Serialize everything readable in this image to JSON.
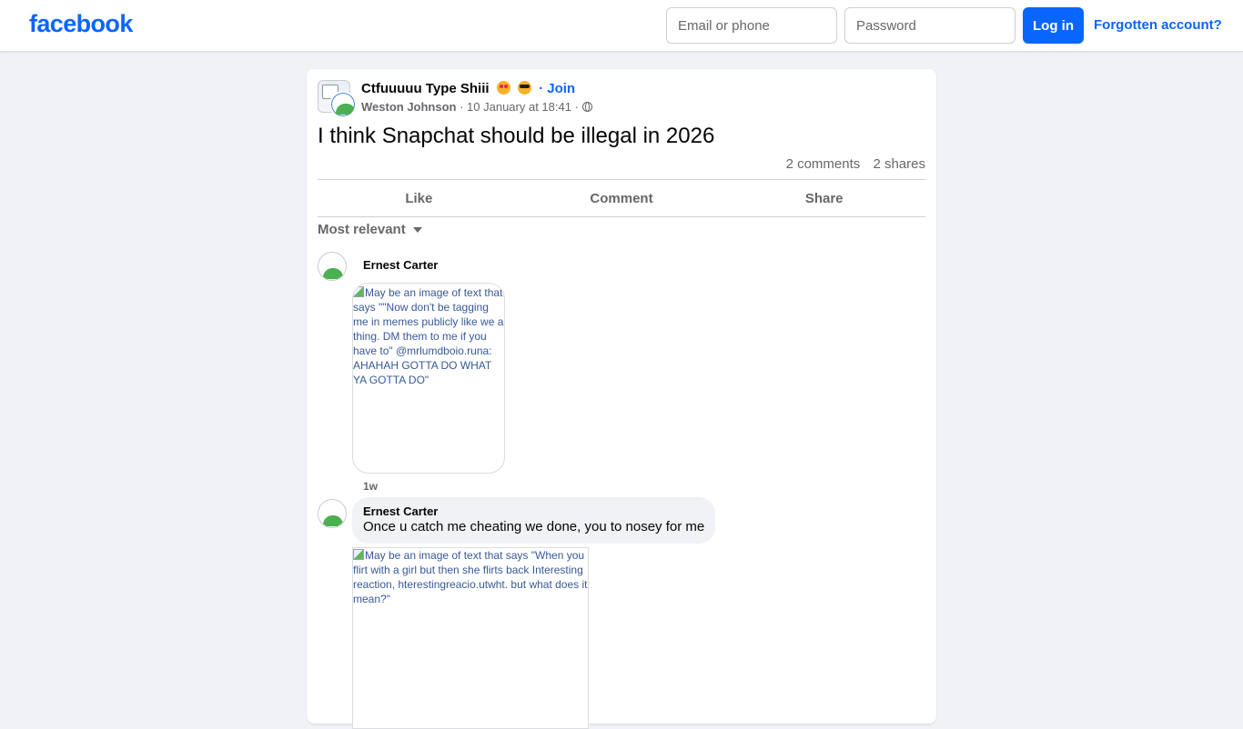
{
  "brand": {
    "logo_text": "facebook",
    "color": "#0866ff"
  },
  "login": {
    "email_placeholder": "Email or phone",
    "password_placeholder": "Password",
    "login_label": "Log in",
    "forgot_label": "Forgotten account?"
  },
  "post": {
    "group_name": "Ctfuuuuu Type Shiii",
    "group_emojis": [
      "heart-eyes-emoji",
      "sunglasses-emoji"
    ],
    "join_label": "· Join",
    "author": "Weston Johnson",
    "date": "· 10 January at 18:41 ·",
    "privacy_icon": "globe-icon",
    "text": "I think Snapchat should be illegal in 2026",
    "comments_count": "2 comments",
    "shares_count": "2 shares",
    "actions": {
      "like": "Like",
      "comment": "Comment",
      "share": "Share"
    },
    "sort_label": "Most relevant"
  },
  "comments": [
    {
      "author": "Ernest Carter",
      "image_alt": "May be an image of text that says \"\"Now don't be tagging me in memes publicly like we a thing. DM them to me if you have to\" @mrlumdboio.runa: AHAHAH GOTTA DO WHAT YA GOTTA DO\"",
      "time": "1w"
    },
    {
      "author": "Ernest Carter",
      "text": "Once u catch me cheating we done, you to nosey for me",
      "image_alt": "May be an image of text that says \"When you flirt with a girl but then she flirts back Interesting reaction, hterestingreacio.utwht. but what does it mean?\""
    }
  ]
}
